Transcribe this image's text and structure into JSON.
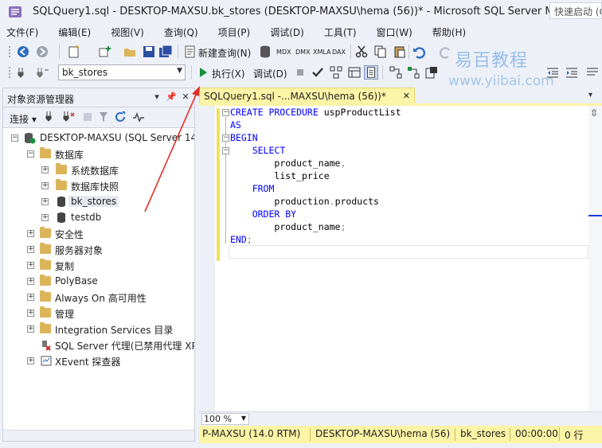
{
  "window": {
    "title": "SQLQuery1.sql - DESKTOP-MAXSU.bk_stores (DESKTOP-MAXSU\\hema (56))* - Microsoft SQL Server Manage...",
    "quick_launch_placeholder": "快速启动 (Ctrl+Q)"
  },
  "menu": [
    "文件(F)",
    "编辑(E)",
    "视图(V)",
    "查询(Q)",
    "项目(P)",
    "调试(D)",
    "工具(T)",
    "窗口(W)",
    "帮助(H)"
  ],
  "toolbar": {
    "new_query_label": "新建查询(N)",
    "mdx_label": "MDX",
    "dmx_label": "DMX",
    "xmla_label": "XMLA",
    "dax_label": "DAX",
    "database_selected": "bk_stores",
    "execute_label": "执行(X)",
    "debug_label": "调试(D)"
  },
  "watermark": {
    "logo": "易百教程",
    "url": "www.yiibai.com"
  },
  "object_explorer": {
    "title": "对象资源管理器",
    "connect_label": "连接",
    "tree": {
      "server": "DESKTOP-MAXSU (SQL Server 14",
      "databases": "数据库",
      "system_databases": "系统数据库",
      "database_snapshots": "数据库快照",
      "bk_stores": "bk_stores",
      "testdb": "testdb",
      "security": "安全性",
      "server_objects": "服务器对象",
      "replication": "复制",
      "polybase": "PolyBase",
      "always_on": "Always On 高可用性",
      "management": "管理",
      "integration_services": "Integration Services 目录",
      "sql_agent": "SQL Server 代理(已禁用代理 XP",
      "xevent": "XEvent 探查器"
    }
  },
  "editor": {
    "tab_label": "SQLQuery1.sql -...MAXSU\\hema (56))*",
    "code": {
      "l1_kw": "CREATE PROCEDURE",
      "l1_name": " uspProductList",
      "l2": "AS",
      "l3": "BEGIN",
      "l4": "SELECT",
      "l5": "product_name",
      "l5_punct": ",",
      "l6": "list_price",
      "l7": "FROM",
      "l8_a": "production",
      "l8_dot": ".",
      "l8_b": "products",
      "l9_kw": "ORDER BY",
      "l10": "product_name",
      "l10_punct": ";",
      "l11": "END",
      "l11_punct": ";"
    },
    "zoom": "100 %"
  },
  "status": {
    "server": "P-MAXSU (14.0 RTM)",
    "user": "DESKTOP-MAXSU\\hema (56)",
    "database": "bk_stores",
    "elapsed": "00:00:00",
    "rows": "0 行"
  },
  "colors": {
    "chrome": "#eef0f7",
    "tab_yellow": "#fcf4a6",
    "keyword_blue": "#0000ff",
    "annotation_red": "#e0302a"
  }
}
